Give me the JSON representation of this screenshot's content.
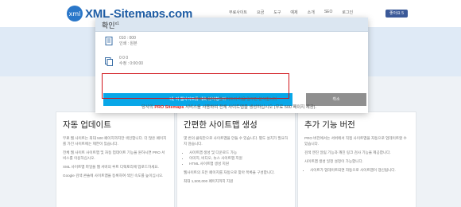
{
  "header": {
    "logo_mark": "xml",
    "logo_text": "XML-Sitemaps.com",
    "nav": [
      "무료사이트",
      "요금",
      "도구",
      "예제",
      "소개",
      "SEO",
      "로그인"
    ],
    "fb_button": "좋아요 5"
  },
  "modal": {
    "title": "확인",
    "title_suffix": "x1",
    "row1": [
      "010 : 000",
      "인쇄 : 원본"
    ],
    "row2": [
      "0    0    0",
      "수정 : 0:00:00"
    ],
    "confirm_label": "네, 이 웹사이트를 계속 분석합니다",
    "cancel_label": "취소",
    "note1": "무료 크롤러는 웹사이트의 처음 일부만 분석합니다",
    "note2_red": "PRO Sitemaps",
    "note2_prefix": "당사의 ",
    "note2_suffix": " 서비스를 사용하여 전체 사이트맵을 생성하십시오 (무료 500 페이지 제공)."
  },
  "columns": [
    {
      "title": "자동 업데이트",
      "paragraphs": [
        "무료 웹 사이트는 최대 500 페이지까지만 색인합니다. 더 많은 페이지를 가진 사이트에는 제한이 있습니다.",
        "전체 웹 사이트 사이트맵 및 자동 업데이트 기능을 원하시면 PRO 서비스를 이용하십시오.",
        "XML 사이트맵 파일을 웹 서버의 루트 디렉토리에 업로드하세요.",
        "Google 검색 콘솔에 사이트맵을 등록하여 색인 속도를 높이십시오."
      ],
      "bullets": []
    },
    {
      "title": "간편한 사이트맵 생성",
      "paragraphs": [
        "몇 번의 클릭만으로 사이트맵을 만들 수 있습니다. 별도 설치가 필요하지 않습니다."
      ],
      "bullets": [
        "사이트맵 생성 및 다운로드 가능",
        "이미지, 비디오, 뉴스 사이트맵 지원",
        "HTML 사이트맵 생성 지원"
      ],
      "paragraphs_after": [
        "웹사이트의 모든 페이지를 자동으로 찾아 목록을 구성합니다.",
        "최대 1,500,000 페이지까지 지원"
      ]
    },
    {
      "title": "추가 기능 버전",
      "paragraphs": [
        "PRO 버전에서는 서버에서 직접 사이트맵을 자동으로 업데이트할 수 있습니다.",
        "검색 엔진 알림 기능과 깨진 링크 검사 기능을 제공합니다.",
        "사이트맵 생성 일정 설정이 가능합니다."
      ],
      "bullets": [
        "사이트가 업데이트되면 자동으로 사이트맵이 갱신됩니다."
      ]
    }
  ]
}
